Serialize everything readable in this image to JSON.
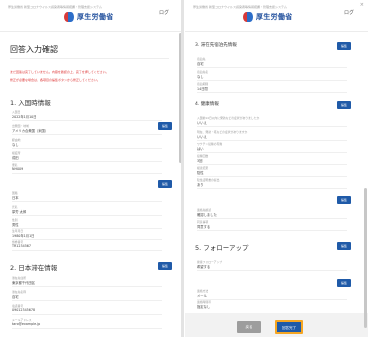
{
  "left": {
    "url": "厚生労働省 新型コロナウイルス感染者等情報把握・管理支援システム",
    "logo_text": "厚生労働省",
    "top_right": "ログ",
    "page_title": "回答入力確認",
    "warnings": [
      "まだ回答は完了していません。内容を確認の上、完了を押してください。",
      "修正が必要な場合は、各項目の編集ボタンから修正してください。"
    ],
    "sections": [
      {
        "title": "1. 入国時情報",
        "edit_label": "編集",
        "fields": [
          {
            "label": "入国日",
            "value": "2022年1月10日"
          },
          {
            "label": "出発国・地域",
            "value": "アメリカ合衆国（米国）"
          },
          {
            "label": "経由地",
            "value": "なし"
          },
          {
            "label": "検疫所",
            "value": "成田"
          },
          {
            "label": "便名",
            "value": "NH009"
          }
        ]
      },
      {
        "title": "",
        "edit_label": "編集",
        "fields": [
          {
            "label": "国籍",
            "value": "日本"
          },
          {
            "label": "氏名",
            "value": "厚労 太郎"
          },
          {
            "label": "性別",
            "value": "男性"
          },
          {
            "label": "生年月日",
            "value": "1980年1月1日"
          },
          {
            "label": "旅券番号",
            "value": "TR1234567"
          }
        ]
      },
      {
        "title": "2. 日本滞在情報",
        "edit_label": "編集",
        "fields": [
          {
            "label": "滞在先住所",
            "value": "東京都千代田区"
          },
          {
            "label": "滞在先名称",
            "value": "自宅"
          },
          {
            "label": "電話番号",
            "value": "09012345678"
          },
          {
            "label": "メールアドレス",
            "value": "taro@example.jp"
          }
        ]
      }
    ]
  },
  "right": {
    "url": "厚生労働省 新型コロナウイルス感染者等情報把握・管理支援システム",
    "logo_text": "厚生労働省",
    "top_right": "ログ",
    "close_label": "×",
    "sections": [
      {
        "title": "3. 滞在先宿泊先情報",
        "edit_label": "編集",
        "fields": [
          {
            "label": "宿泊先",
            "value": "自宅"
          },
          {
            "label": "宿泊先名",
            "value": "なし"
          },
          {
            "label": "宿泊期間",
            "value": "14日間"
          }
        ]
      },
      {
        "title": "4. 健康情報",
        "edit_label": "編集",
        "fields": [
          {
            "label": "入国前14日以内に発熱などの症状がありましたか",
            "value": "いいえ"
          },
          {
            "label": "現在、発熱・咳などの症状がありますか",
            "value": "いいえ"
          },
          {
            "label": "ワクチン接種の有無",
            "value": "はい"
          },
          {
            "label": "接種回数",
            "value": "3回"
          },
          {
            "label": "検査結果",
            "value": "陰性"
          },
          {
            "label": "陰性証明書の提出",
            "value": "あり"
          }
        ]
      },
      {
        "title": "",
        "edit_label": "編集",
        "fields": [
          {
            "label": "連絡先確認",
            "value": "確認しました"
          },
          {
            "label": "同意事項",
            "value": "同意する"
          }
        ]
      },
      {
        "title": "5. フォローアップ",
        "edit_label": "編集",
        "fields": [
          {
            "label": "健康フォローアップ",
            "value": "希望する"
          }
        ]
      },
      {
        "title": "",
        "edit_label": "編集",
        "fields": [
          {
            "label": "連絡方法",
            "value": "メール"
          },
          {
            "label": "連絡時間帯",
            "value": "指定なし"
          }
        ]
      }
    ],
    "back_label": "戻る",
    "confirm_label": "回答完了"
  }
}
